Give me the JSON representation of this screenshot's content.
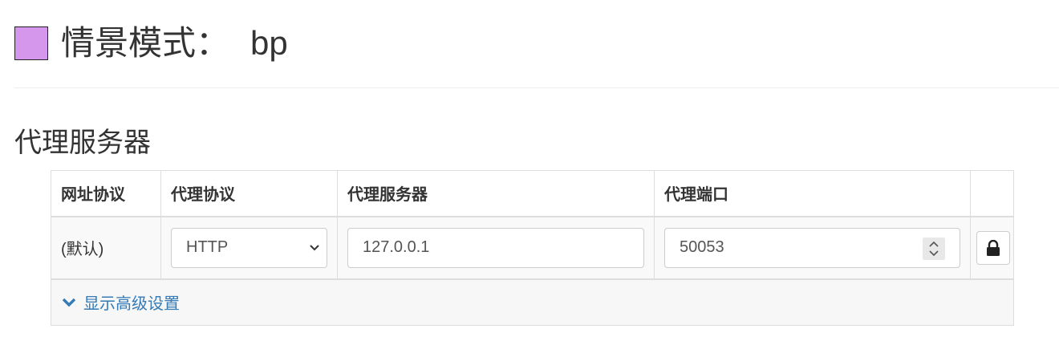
{
  "profile": {
    "title": "情景模式：",
    "name": "bp",
    "color": "#d597ec"
  },
  "section": {
    "title": "代理服务器"
  },
  "table": {
    "headers": [
      "网址协议",
      "代理协议",
      "代理服务器",
      "代理端口"
    ],
    "row": {
      "scheme_label": "(默认)",
      "protocol": "HTTP",
      "server": "127.0.0.1",
      "port": "50053"
    },
    "lock_icon": "lock-icon"
  },
  "advanced": {
    "label": "显示高级设置",
    "icon": "chevron-down-icon",
    "color": "#337ab7"
  }
}
